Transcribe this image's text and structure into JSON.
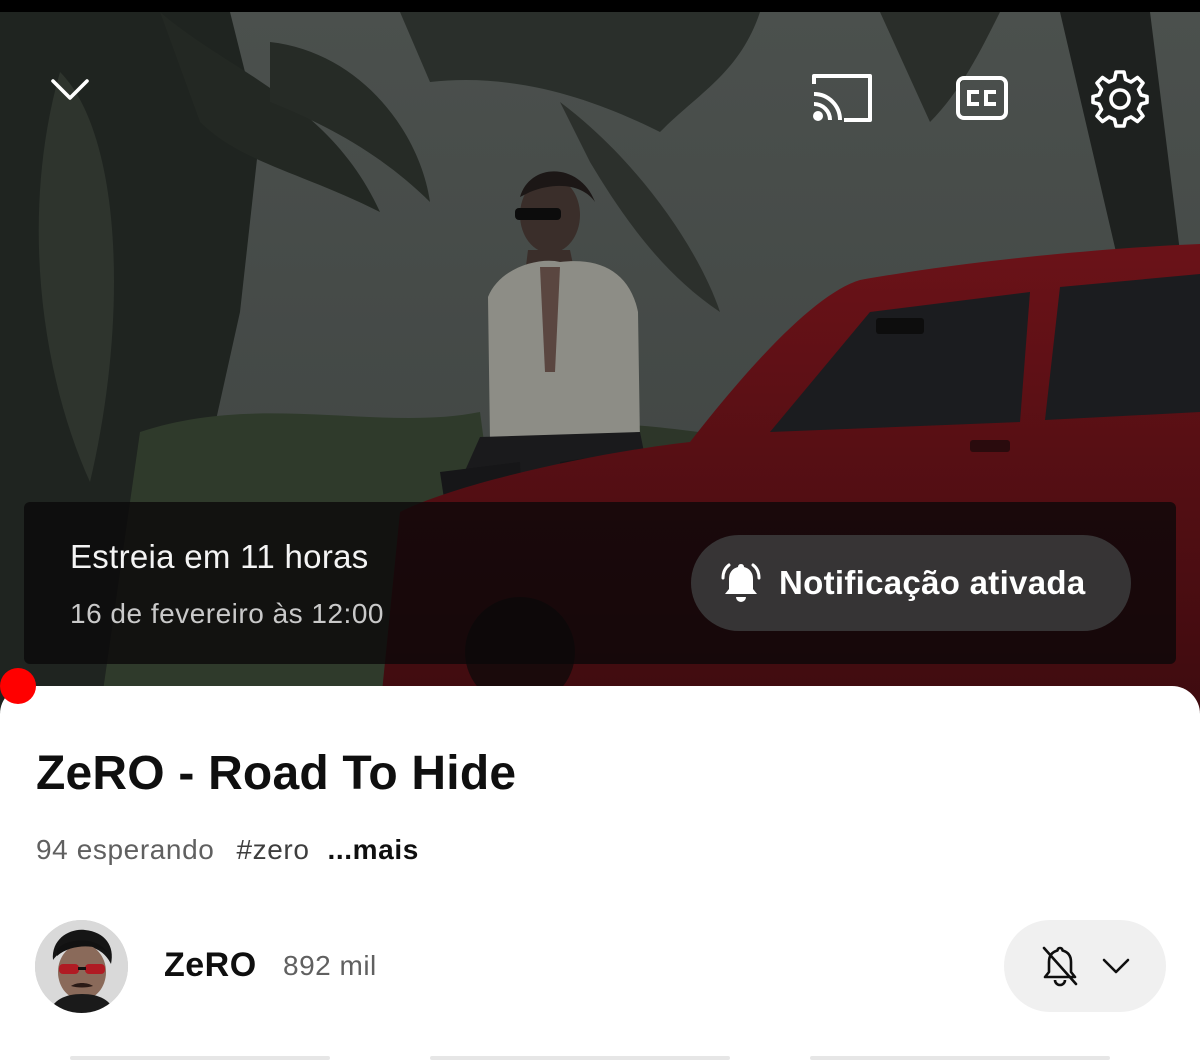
{
  "player": {
    "icons": {
      "collapse": "chevron-down-icon",
      "cast": "cast-icon",
      "captions": "closed-captions-icon",
      "settings": "gear-icon"
    },
    "premiere": {
      "title": "Estreia em 11 horas",
      "date": "16 de fevereiro às 12:00",
      "notify_button_label": "Notificação ativada",
      "notify_icon": "bell-ringing-icon"
    },
    "progress_color": "#ff0000"
  },
  "video": {
    "title": "ZeRO - Road To Hide",
    "waiting": "94 esperando",
    "hashtag": "#zero",
    "more_label": "...mais"
  },
  "channel": {
    "name": "ZeRO",
    "subscribers": "892 mil",
    "notification_icon": "bell-off-icon",
    "dropdown_icon": "chevron-down-icon"
  },
  "colors": {
    "accent": "#ff0000",
    "sheet_background": "#ffffff",
    "text_primary": "#0f0f0f",
    "text_secondary": "#606060"
  }
}
